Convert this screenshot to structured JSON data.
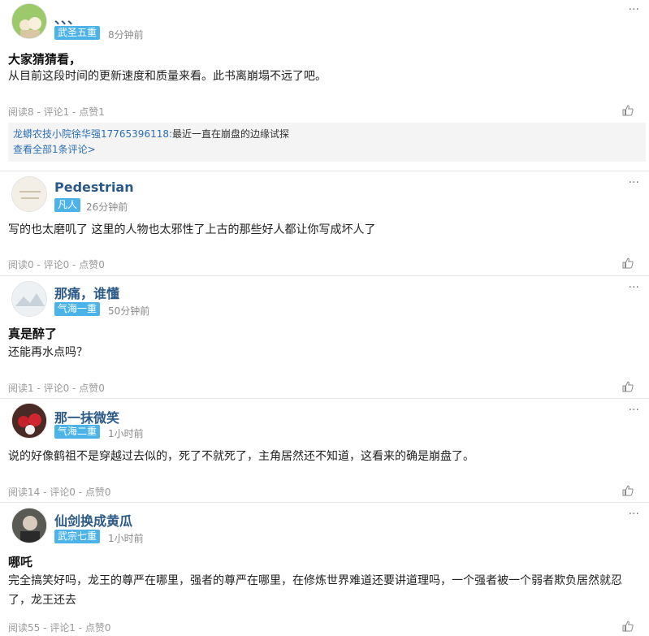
{
  "posts": [
    {
      "username": "、、、",
      "badge": "武圣五重",
      "time": "8分钟前",
      "title": "大家猜猜看，",
      "body": "从目前这段时间的更新速度和质量来看。此书离崩塌不远了吧。",
      "stats": "阅读8 - 评论1 - 点赞1",
      "reply": {
        "name": "龙蟒农技小院徐华强17765396118:",
        "text": "最近一直在崩盘的边缘试探",
        "view_all": "查看全部1条评论>"
      }
    },
    {
      "username": "Pedestrian",
      "badge": "凡人",
      "time": "26分钟前",
      "title": "",
      "body": "写的也太磨叽了  这里的人物也太邪性了上古的那些好人都让你写成坏人了",
      "stats": "阅读0 - 评论0 - 点赞0"
    },
    {
      "username": "那痛，谁懂",
      "badge": "气海一重",
      "time": "50分钟前",
      "title": "真是醉了",
      "body": "还能再水点吗？",
      "stats": "阅读1 - 评论0 - 点赞0"
    },
    {
      "username": "那一抹微笑",
      "badge": "气海二重",
      "time": "1小时前",
      "title": "",
      "body": "说的好像鹤祖不是穿越过去似的，死了不就死了，主角居然还不知道，这看来的确是崩盘了。",
      "stats": "阅读14 - 评论0 - 点赞0"
    },
    {
      "username": "仙剑换成黄瓜",
      "badge": "武宗七重",
      "time": "1小时前",
      "title": "哪吒",
      "body": "完全搞笑好吗，龙王的尊严在哪里，强者的尊严在哪里，在修炼世界难道还要讲道理吗，一个强者被一个弱者欺负居然就忍了，龙王还去",
      "stats": "阅读55 - 评论1 - 点赞0"
    }
  ],
  "icons": {
    "more": "more-dots-icon",
    "like": "thumb-up-icon"
  },
  "colors": {
    "username": "#2c5a86",
    "badge": "#4cb3e8",
    "reply_link": "#2c6fb5"
  }
}
